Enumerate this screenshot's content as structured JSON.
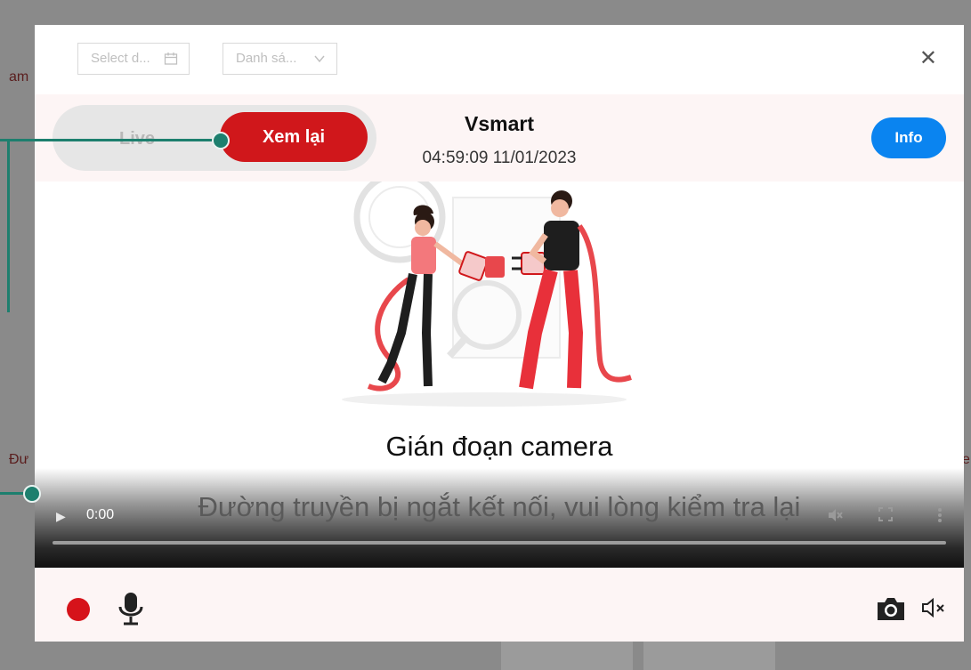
{
  "toolbar": {
    "date_placeholder": "Select d...",
    "list_placeholder": "Danh sá...",
    "close_symbol": "✕"
  },
  "background": {
    "frag_left_top": "am",
    "frag_left_mid": "Đư",
    "frag_right_mid": "e"
  },
  "header": {
    "mode_live": "Live",
    "mode_replay": "Xem lại",
    "device_name": "Vsmart",
    "timestamp": "04:59:09 11/01/2023",
    "info_label": "Info"
  },
  "video": {
    "error_title": "Gián đoạn camera",
    "error_message": "Đường truyền bị ngắt kết nối, vui lòng kiểm tra lại",
    "current_time": "0:00",
    "play_symbol": "▶",
    "muted_symbol": "🔇",
    "fullscreen_symbol": "⛶",
    "menu_symbol": "⋮"
  },
  "footer": {
    "speaker_icon": "speaker-muted-icon",
    "camera_icon": "camera-icon",
    "mic_icon": "microphone-icon",
    "record_icon": "record-dot-icon"
  },
  "colors": {
    "accent_red": "#d0171b",
    "info_blue": "#0a84f0",
    "callout_teal": "#1d7f6e",
    "header_tint": "#fdf5f5"
  }
}
